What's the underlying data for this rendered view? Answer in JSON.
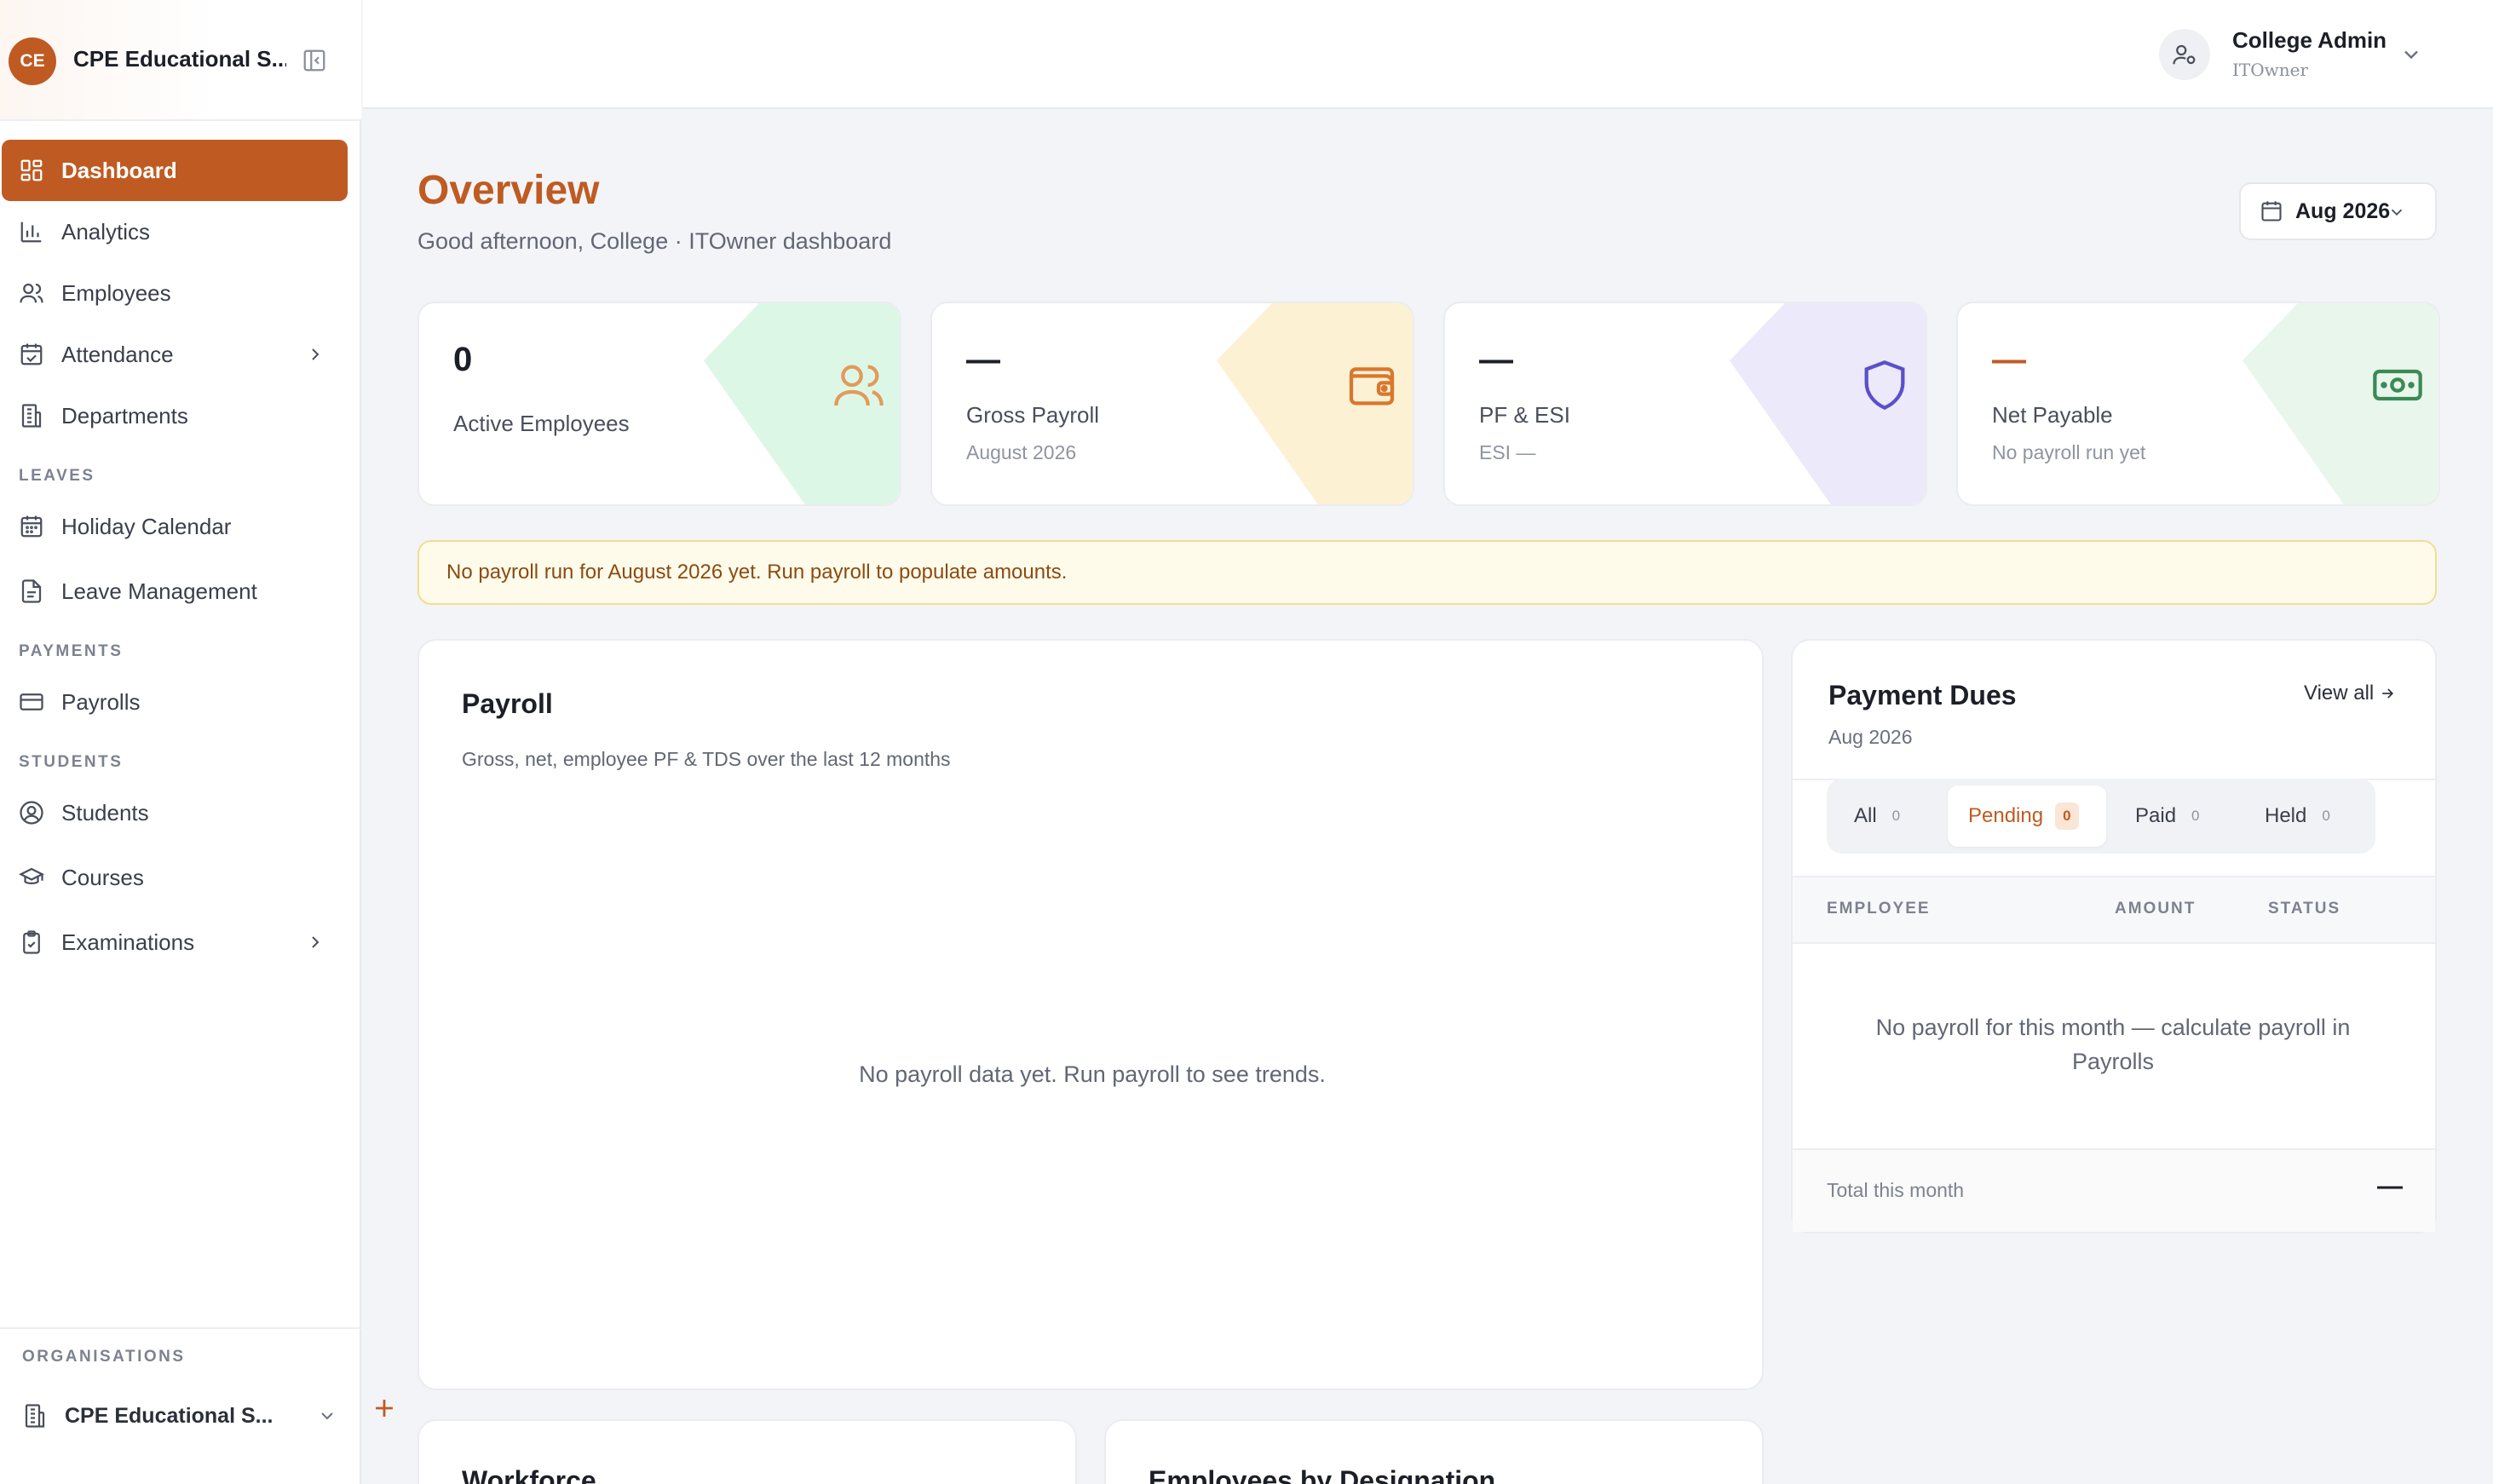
{
  "sidebar": {
    "brand_initials": "CE",
    "brand_name": "CPE Educational S...",
    "sections": {
      "leaves": "LEAVES",
      "payments": "PAYMENTS",
      "students": "STUDENTS",
      "organisations": "ORGANISATIONS"
    },
    "items": {
      "dashboard": "Dashboard",
      "analytics": "Analytics",
      "employees": "Employees",
      "attendance": "Attendance",
      "departments": "Departments",
      "holiday_calendar": "Holiday Calendar",
      "leave_management": "Leave Management",
      "payrolls": "Payrolls",
      "students": "Students",
      "courses": "Courses",
      "examinations": "Examinations"
    },
    "org_name": "CPE Educational S..."
  },
  "topbar": {
    "user_name": "College Admin",
    "user_role": "ITOwner"
  },
  "overview": {
    "title": "Overview",
    "subtitle": "Good afternoon, College · ITOwner dashboard",
    "month": "Aug 2026"
  },
  "kpis": {
    "active_employees": {
      "value": "0",
      "label": "Active Employees"
    },
    "gross_payroll": {
      "value": "—",
      "label": "Gross Payroll",
      "sub": "August 2026"
    },
    "pf_esi": {
      "value": "—",
      "label": "PF & ESI",
      "sub": "ESI —"
    },
    "net_payable": {
      "value": "—",
      "label": "Net Payable",
      "sub": "No payroll run yet"
    }
  },
  "alert": "No payroll run for August 2026 yet. Run payroll to populate amounts.",
  "payroll_card": {
    "title": "Payroll",
    "subtitle": "Gross, net, employee PF & TDS over the last 12 months",
    "empty": "No payroll data yet. Run payroll to see trends."
  },
  "dues": {
    "title": "Payment Dues",
    "month": "Aug 2026",
    "view_all": "View all",
    "tabs": {
      "all": {
        "label": "All",
        "count": "0"
      },
      "pending": {
        "label": "Pending",
        "count": "0"
      },
      "paid": {
        "label": "Paid",
        "count": "0"
      },
      "held": {
        "label": "Held",
        "count": "0"
      }
    },
    "columns": {
      "employee": "EMPLOYEE",
      "amount": "AMOUNT",
      "status": "STATUS"
    },
    "empty": "No payroll for this month — calculate payroll in Payrolls",
    "total_label": "Total this month",
    "total_value": "—"
  },
  "bottom_cards": {
    "workforce": "Workforce",
    "designation": "Employees by Designation"
  },
  "colors": {
    "accent": "#bf5b22",
    "kpi_green": "#dcf7e6",
    "kpi_yellow": "#fdf1d4",
    "kpi_purple": "#ece9fb",
    "kpi_mint": "#e9f6ec"
  }
}
